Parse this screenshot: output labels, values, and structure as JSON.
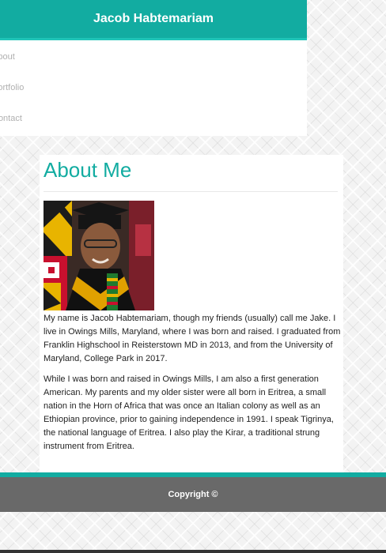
{
  "header": {
    "brand": "Jacob Habtemariam"
  },
  "nav": {
    "items": [
      {
        "label": "About"
      },
      {
        "label": "Portfolio"
      },
      {
        "label": "Contact"
      }
    ]
  },
  "main": {
    "title": "About Me",
    "bio_paragraph_1": "My name is Jacob Habtemariam, though my friends (usually) call me Jake. I live in Owings Mills, Maryland, where I was born and raised. I graduated from Franklin Highschool in Reisterstown MD in 2013, and from the University of Maryland, College Park in 2017.",
    "bio_paragraph_2": "While I was born and raised in Owings Mills, I am also a first generation American. My parents and my older sister were all born in Eritrea, a small nation in the Horn of Africa that was once an Italian colony as well as an Ethiopian province, prior to gaining independence in 1991. I speak Tigrinya, the national language of Eritrea. I also play the Kirar, a traditional strung instrument from Eritrea."
  },
  "footer": {
    "copyright": "Copyright ©"
  },
  "colors": {
    "accent": "#12aca1",
    "footer_bg": "#696969"
  }
}
